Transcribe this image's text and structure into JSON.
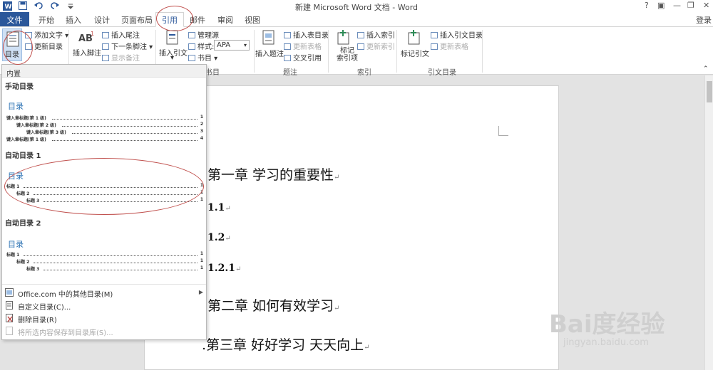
{
  "window": {
    "title": "新建 Microsoft Word 文档 - Word",
    "controls": [
      "?",
      "▣",
      "—",
      "❐",
      "✕"
    ]
  },
  "quick_access": [
    "word-logo-icon",
    "save-icon",
    "undo-icon",
    "redo-icon",
    "customize-icon"
  ],
  "tabs": [
    {
      "label": "文件"
    },
    {
      "label": "开始"
    },
    {
      "label": "插入"
    },
    {
      "label": "设计"
    },
    {
      "label": "页面布局"
    },
    {
      "label": "引用",
      "active": true
    },
    {
      "label": "邮件"
    },
    {
      "label": "审阅"
    },
    {
      "label": "视图"
    }
  ],
  "login": "登录",
  "ribbon": {
    "toc_group": {
      "toc_button": "目录",
      "add_text": "添加文字",
      "update_toc": "更新目录"
    },
    "footnotes_group": {
      "insert_footnote": "插入脚注",
      "insert_endnote": "插入尾注",
      "next_footnote": "下一条脚注",
      "show_notes": "显示备注"
    },
    "citations_group": {
      "insert_citation": "插入引文",
      "manage_sources": "管理源",
      "style_label": "样式:",
      "style_value": "APA",
      "bibliography": "书目",
      "group_label": "书目"
    },
    "captions_group": {
      "insert_caption": "插入题注",
      "insert_table_of_figures": "插入表目录",
      "update_table": "更新表格",
      "cross_reference": "交叉引用",
      "group_label": "题注"
    },
    "index_group": {
      "mark_entry": "标记\n索引项",
      "insert_index": "插入索引",
      "update_index": "更新索引",
      "group_label": "索引"
    },
    "authorities_group": {
      "mark_citation": "标记引文",
      "insert_table_of_authorities": "插入引文目录",
      "update_table": "更新表格",
      "group_label": "引文目录"
    }
  },
  "dropdown": {
    "header": "内置",
    "manual": {
      "label": "手动目录",
      "title": "目录",
      "lines": [
        {
          "text": "键入章标题(第 1 级)",
          "page": "1"
        },
        {
          "text": "键入章标题(第 2 级)",
          "page": "2"
        },
        {
          "text": "键入章标题(第 3 级)",
          "page": "3"
        },
        {
          "text": "键入章标题(第 1 级)",
          "page": "4"
        }
      ]
    },
    "auto1": {
      "label": "自动目录 1",
      "title": "目录",
      "lines": [
        {
          "text": "标题 1",
          "page": "1"
        },
        {
          "text": "标题 2",
          "page": "1"
        },
        {
          "text": "标题 3",
          "page": "1"
        }
      ]
    },
    "auto2": {
      "label": "自动目录 2",
      "title": "目录",
      "lines": [
        {
          "text": "标题 1",
          "page": "1"
        },
        {
          "text": "标题 2",
          "page": "1"
        },
        {
          "text": "标题 3",
          "page": "1"
        }
      ]
    },
    "menu": {
      "office_more": "Office.com 中的其他目录(M)",
      "custom": "自定义目录(C)...",
      "delete": "删除目录(R)",
      "save_selection": "将所选内容保存到目录库(S)..."
    }
  },
  "document": {
    "h1_1": "第一章  学习的重要性",
    "h2_1": "1.1",
    "h2_2": "1.2",
    "h3_1": "1.2.1",
    "h1_2": "第二章  如何有效学习",
    "h1_3": ".第三章  好好学习  天天向上",
    "pilcrow": "↵"
  },
  "watermark": {
    "brand": "Bai度经验",
    "url": "jingyan.baidu.com"
  },
  "colors": {
    "word_blue": "#2b579a",
    "toc_title_blue": "#2e74b5",
    "annotation_red": "#c0504d"
  }
}
